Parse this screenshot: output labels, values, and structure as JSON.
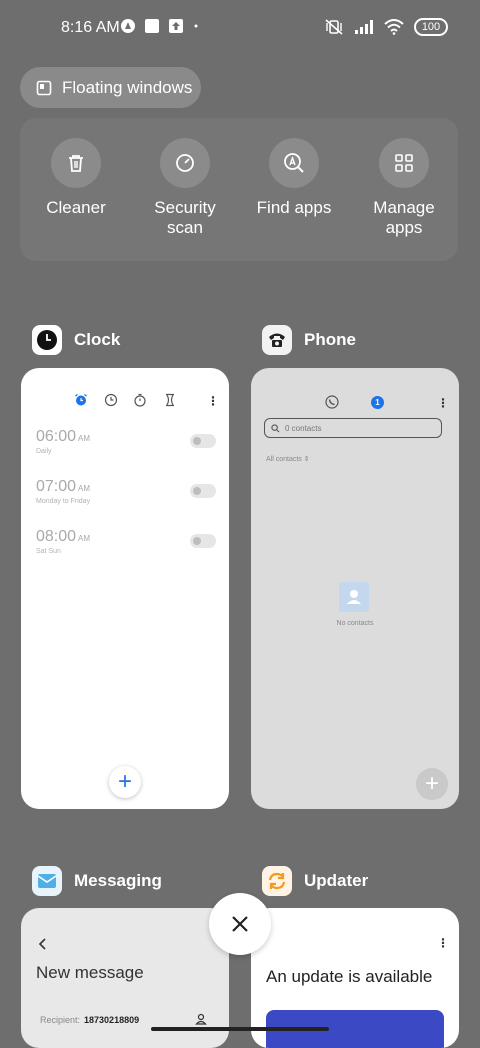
{
  "status_bar": {
    "time": "8:16 AM",
    "left_icons": [
      "app-notification-icon",
      "square-notification-icon",
      "upload-notification-icon",
      "dot-icon"
    ],
    "right_icons": [
      "mute-vibrate-icon",
      "signal-icon",
      "wifi-icon"
    ],
    "battery": "100"
  },
  "floating_windows": {
    "label": "Floating windows"
  },
  "tools": [
    {
      "label": "Cleaner",
      "icon": "trash-icon"
    },
    {
      "label": "Security scan",
      "icon": "security-scan-icon"
    },
    {
      "label": "Find apps",
      "icon": "find-apps-icon"
    },
    {
      "label": "Manage apps",
      "icon": "grid-icon"
    }
  ],
  "apps": {
    "clock": {
      "name": "Clock",
      "alarms": [
        {
          "time": "06:00",
          "ampm": "AM",
          "sub": "Daily"
        },
        {
          "time": "07:00",
          "ampm": "AM",
          "sub": "Monday to Friday"
        },
        {
          "time": "08:00",
          "ampm": "AM",
          "sub": "Sat Sun"
        }
      ],
      "fab": "+"
    },
    "phone": {
      "name": "Phone",
      "search_placeholder": "0 contacts",
      "filter": "All contacts",
      "empty_text": "No contacts",
      "fab": "+",
      "tab_badge": "1"
    },
    "messaging": {
      "name": "Messaging",
      "title": "New message",
      "recipient_label": "Recipient:",
      "recipient_number": "18730218809"
    },
    "updater": {
      "name": "Updater",
      "title": "An update is available"
    }
  },
  "colors": {
    "background": "#6e6e6e",
    "accent": "#1e73e8",
    "updater_banner": "#3c49c4"
  }
}
